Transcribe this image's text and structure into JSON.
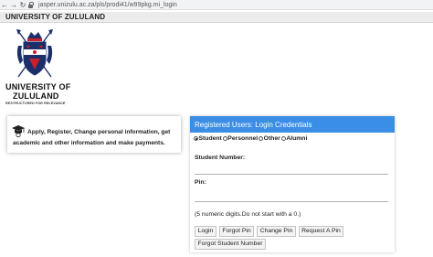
{
  "browser": {
    "url": "jasper.unizulu.ac.za/pls/prodi41/w99pkg.mi_login"
  },
  "header": {
    "title": "UNIVERSITY OF ZULULAND"
  },
  "logo": {
    "line1": "UNIVERSITY OF",
    "line2": "ZULULAND",
    "tagline": "RESTRUCTURED FOR RELEVANCE",
    "colors": {
      "navy": "#1d2f6b",
      "red": "#c8202c",
      "white": "#ffffff"
    }
  },
  "info_card": {
    "icon": "graduation-cap-icon",
    "line1": "Apply, Register, Change personal information, get",
    "line2": "academic and other information and make payments."
  },
  "login_panel": {
    "title": "Registered Users: Login Credentials",
    "header_color": "#3a8ee6",
    "user_types": [
      {
        "label": "Student",
        "checked": true
      },
      {
        "label": "Personnel",
        "checked": false
      },
      {
        "label": "Other",
        "checked": false
      },
      {
        "label": "Alumni",
        "checked": false
      }
    ],
    "student_number_label": "Student Number:",
    "student_number_value": "",
    "pin_label": "Pin:",
    "pin_value": "",
    "pin_hint": "(5 numeric digits.Do not start with a 0.)",
    "buttons": {
      "login": "Login",
      "forgot_pin": "Forgot Pin",
      "change_pin": "Change Pin",
      "request_pin": "Request A Pin",
      "forgot_student_number": "Forgot Student Number"
    }
  }
}
